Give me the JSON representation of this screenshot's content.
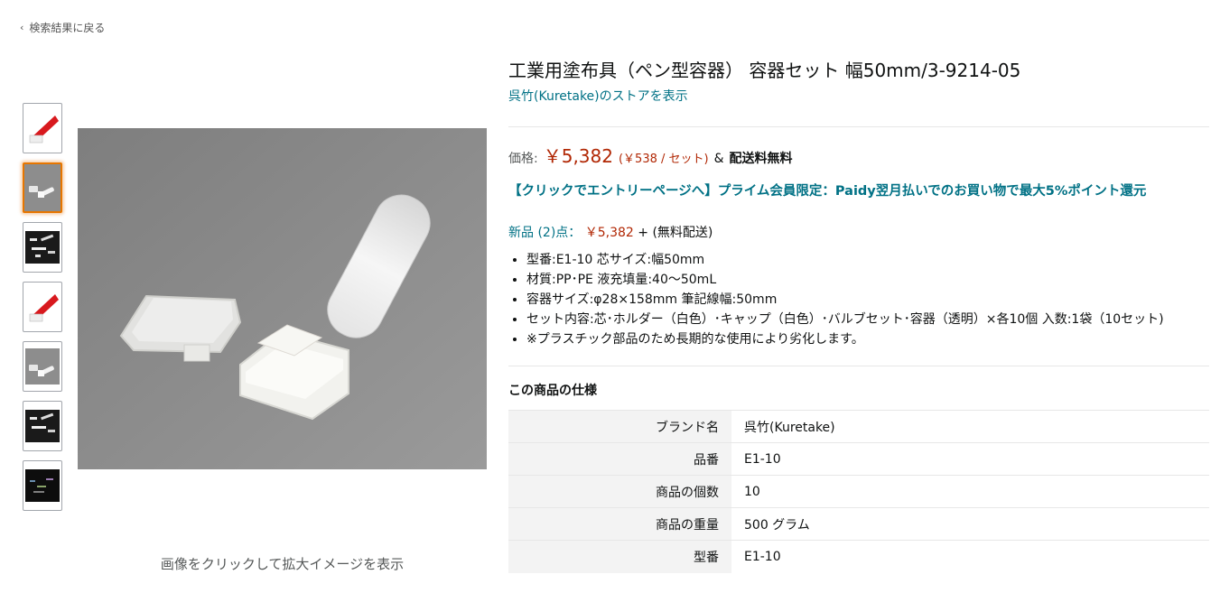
{
  "nav": {
    "back_label": "検索結果に戻る"
  },
  "gallery": {
    "zoom_hint": "画像をクリックして拡大イメージを表示",
    "thumbnails": [
      {
        "name": "thumb-1",
        "selected": false
      },
      {
        "name": "thumb-2",
        "selected": true
      },
      {
        "name": "thumb-3",
        "selected": false
      },
      {
        "name": "thumb-4",
        "selected": false
      },
      {
        "name": "thumb-5",
        "selected": false
      },
      {
        "name": "thumb-6",
        "selected": false
      },
      {
        "name": "thumb-7",
        "selected": false
      }
    ]
  },
  "product": {
    "title": "工業用塗布具（ペン型容器） 容器セット 幅50mm/3-9214-05",
    "store_link": "呉竹(Kuretake)のストアを表示",
    "price_label": "価格:",
    "price": "￥5,382",
    "unit_price": "(￥538 / セット)",
    "amp": "&",
    "free_shipping": "配送料無料",
    "promo": "【クリックでエントリーページへ】プライム会員限定：Paidy翌月払いでのお買い物で最大5%ポイント還元",
    "new_offers_link": "新品 (2)点：",
    "new_offers_price": "￥5,382",
    "new_offers_suffix": "+ (無料配送)",
    "bullets": [
      "型番:E1-10 芯サイズ:幅50mm",
      "材質:PP･PE 液充填量:40～50mL",
      "容器サイズ:φ28×158mm 筆記線幅:50mm",
      "セット内容:芯･ホルダー（白色）･キャップ（白色）･バルブセット･容器（透明）×各10個 入数:1袋（10セット)",
      "※プラスチック部品のため長期的な使用により劣化します。"
    ]
  },
  "specs": {
    "title": "この商品の仕様",
    "rows": [
      {
        "key": "ブランド名",
        "value": "呉竹(Kuretake)"
      },
      {
        "key": "品番",
        "value": "E1-10"
      },
      {
        "key": "商品の個数",
        "value": "10"
      },
      {
        "key": "商品の重量",
        "value": "500 グラム"
      },
      {
        "key": "型番",
        "value": "E1-10"
      }
    ]
  },
  "colors": {
    "link": "#007185",
    "price": "#b12704",
    "selected_border": "#e77600"
  }
}
